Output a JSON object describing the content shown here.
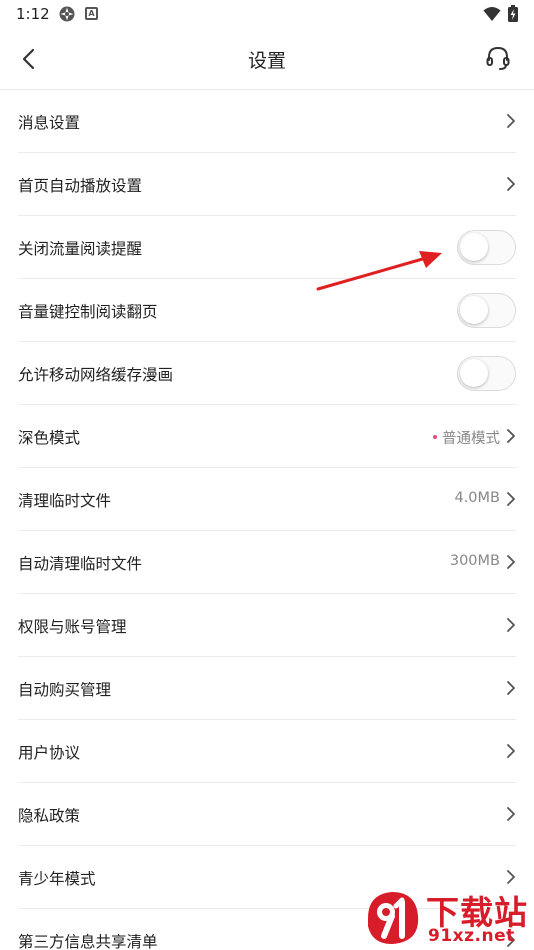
{
  "status_bar": {
    "time": "1:12",
    "notification_icon_letter": "A"
  },
  "nav": {
    "title": "设置",
    "back_icon": "back-arrow-icon",
    "support_icon": "headset-icon"
  },
  "settings": [
    {
      "label": "消息设置",
      "control": "chevron"
    },
    {
      "label": "首页自动播放设置",
      "control": "chevron"
    },
    {
      "label": "关闭流量阅读提醒",
      "control": "toggle",
      "on": false
    },
    {
      "label": "音量键控制阅读翻页",
      "control": "toggle",
      "on": false
    },
    {
      "label": "允许移动网络缓存漫画",
      "control": "toggle",
      "on": false
    },
    {
      "label": "深色模式",
      "control": "value",
      "value": "普通模式"
    },
    {
      "label": "清理临时文件",
      "control": "value",
      "value": "4.0MB"
    },
    {
      "label": "自动清理临时文件",
      "control": "value",
      "value": "300MB"
    },
    {
      "label": "权限与账号管理",
      "control": "chevron"
    },
    {
      "label": "自动购买管理",
      "control": "chevron"
    },
    {
      "label": "用户协议",
      "control": "chevron"
    },
    {
      "label": "隐私政策",
      "control": "chevron"
    },
    {
      "label": "青少年模式",
      "control": "chevron"
    },
    {
      "label": "第三方信息共享清单",
      "control": "chevron"
    }
  ],
  "watermark": {
    "cn_text": "下载站",
    "url_text": "91xz.net"
  },
  "colors": {
    "accent_dot": "#e8487a",
    "annotation_arrow": "#e02020",
    "watermark": "#d81d2a",
    "divider": "#ececec",
    "value_text": "#888888"
  }
}
